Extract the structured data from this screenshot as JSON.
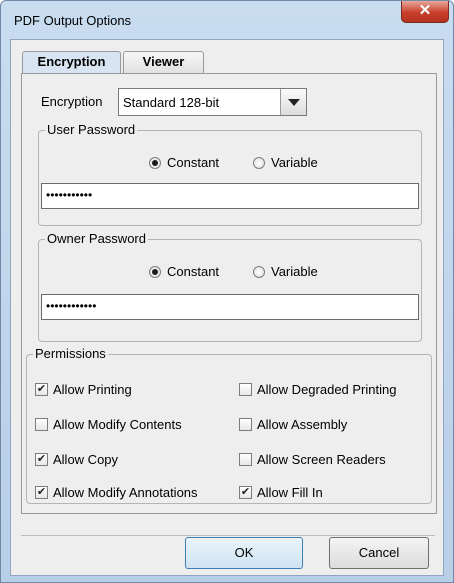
{
  "window": {
    "title": "PDF Output Options",
    "close_glyph": "✕"
  },
  "tabs": [
    {
      "label": "Encryption",
      "active": true
    },
    {
      "label": "Viewer",
      "active": false
    }
  ],
  "encryption": {
    "label": "Encryption",
    "value": "Standard 128-bit"
  },
  "user_password": {
    "title": "User Password",
    "options": [
      "Constant",
      "Variable"
    ],
    "selected": "Constant",
    "value": "•••••••••••"
  },
  "owner_password": {
    "title": "Owner Password",
    "options": [
      "Constant",
      "Variable"
    ],
    "selected": "Constant",
    "value": "••••••••••••"
  },
  "permissions": {
    "title": "Permissions",
    "items": [
      {
        "label": "Allow Printing",
        "checked": true
      },
      {
        "label": "Allow Degraded Printing",
        "checked": false
      },
      {
        "label": "Allow Modify Contents",
        "checked": false
      },
      {
        "label": "Allow Assembly",
        "checked": false
      },
      {
        "label": "Allow Copy",
        "checked": true
      },
      {
        "label": "Allow Screen Readers",
        "checked": false
      },
      {
        "label": "Allow Modify Annotations",
        "checked": true
      },
      {
        "label": "Allow Fill In",
        "checked": true
      }
    ]
  },
  "buttons": {
    "ok": "OK",
    "cancel": "Cancel"
  }
}
